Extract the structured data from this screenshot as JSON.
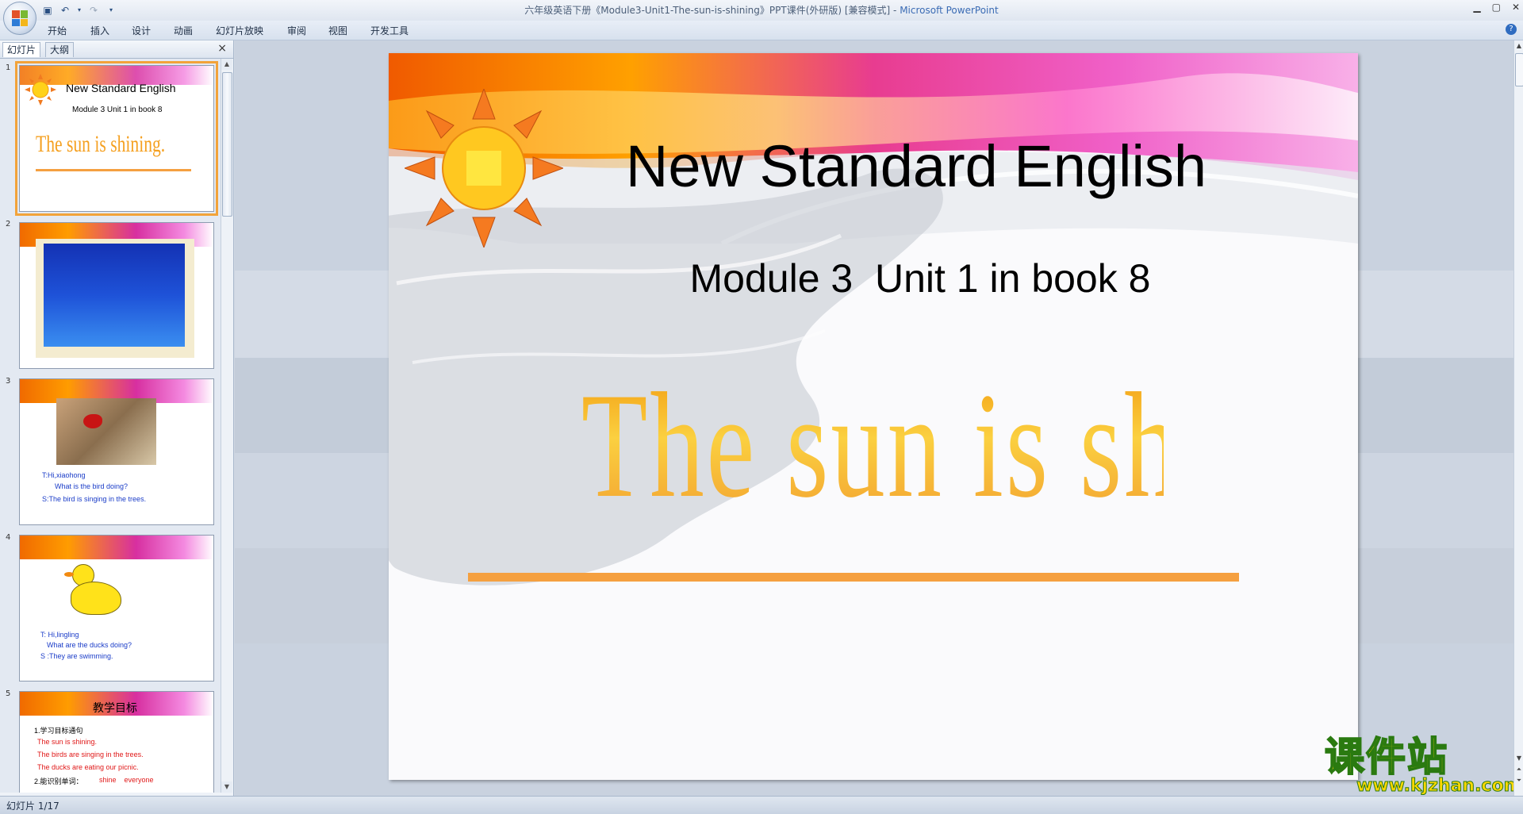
{
  "window": {
    "title": "六年级英语下册《Module3-Unit1-The-sun-is-shining》PPT课件(外研版) [兼容模式] - ",
    "app_name": "Microsoft PowerPoint"
  },
  "ribbon": {
    "tabs": [
      "开始",
      "插入",
      "设计",
      "动画",
      "幻灯片放映",
      "审阅",
      "视图",
      "开发工具"
    ]
  },
  "left_panel": {
    "tabs": [
      "幻灯片",
      "大纲"
    ],
    "close": "×"
  },
  "thumbnails": [
    {
      "num": "1",
      "title": "New Standard English",
      "subtitle": "Module 3  Unit 1 in book 8",
      "wordart": "The sun is shining."
    },
    {
      "num": "2"
    },
    {
      "num": "3",
      "line1": "T:Hi,xiaohong",
      "line2": "What is the bird doing?",
      "line3": "S:The bird is singing in the trees."
    },
    {
      "num": "4",
      "line1": "T: Hi,lingling",
      "line2": "What are the ducks doing?",
      "line3": "S :They are swimming."
    },
    {
      "num": "5",
      "title": "教学目标",
      "line1": "1.学习目标通句",
      "line2": "The sun is shining.",
      "line3": "The birds are singing in the trees.",
      "line4": "The ducks are eating our picnic.",
      "line5": "2.能识别单词：",
      "line5b": "shine    everyone"
    }
  ],
  "slide": {
    "title": "New Standard English",
    "subtitle": "Module 3  Unit 1 in book 8",
    "wordart": "The sun is shining."
  },
  "watermark": {
    "cn": "课件站",
    "url": "www.kjzhan.com"
  },
  "statusbar": {
    "slide_info": "幻灯片 1/17"
  }
}
